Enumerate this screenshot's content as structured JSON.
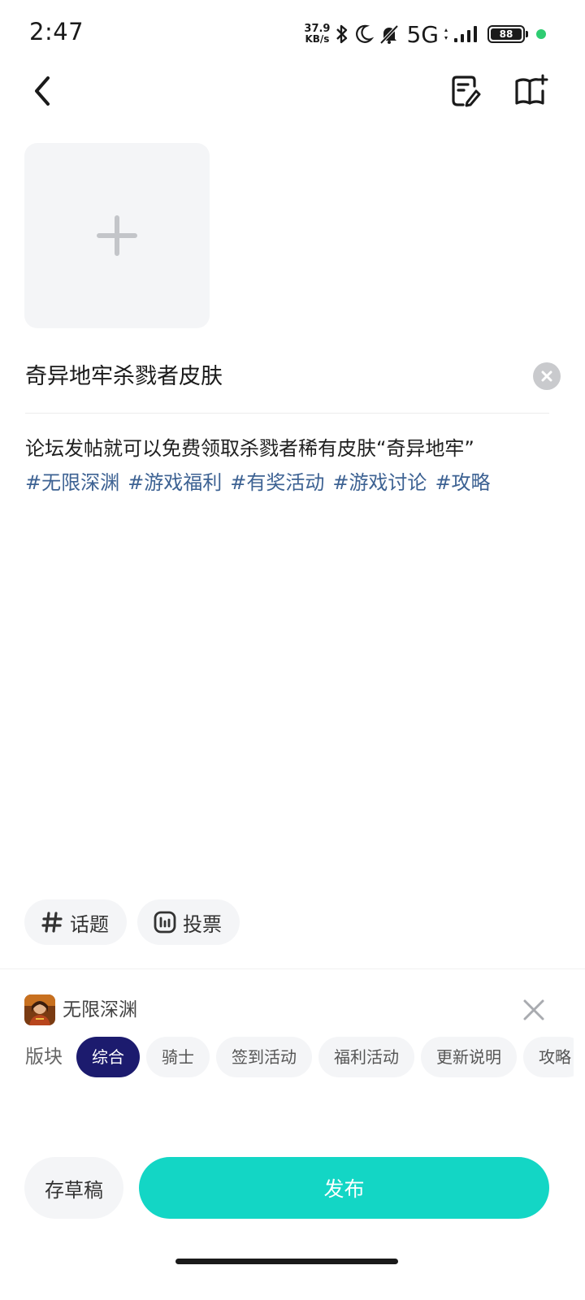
{
  "status_bar": {
    "time": "2:47",
    "net_speed_value": "37.9",
    "net_speed_unit": "KB/s",
    "network_type": "5G",
    "battery_level": "88",
    "icons": [
      "bluetooth-icon",
      "moon-icon",
      "bell-muted-icon",
      "signal-icon",
      "battery-icon"
    ]
  },
  "header": {
    "icons": [
      "back-icon",
      "edit-note-icon",
      "guide-book-icon"
    ]
  },
  "editor": {
    "title": "奇异地牢杀戮者皮肤",
    "body": "论坛发帖就可以免费领取杀戮者稀有皮肤“奇异地牢”",
    "tags": [
      "#无限深渊",
      "#游戏福利",
      "#有奖活动",
      "#游戏讨论",
      "#攻略"
    ]
  },
  "tools": {
    "topic_label": "话题",
    "vote_label": "投票"
  },
  "game": {
    "name": "无限深渊"
  },
  "board": {
    "label": "版块",
    "selected": "综合",
    "options": [
      "综合",
      "骑士",
      "签到活动",
      "福利活动",
      "更新说明",
      "攻略"
    ]
  },
  "actions": {
    "draft_label": "存草稿",
    "publish_label": "发布"
  },
  "colors": {
    "accent": "#13d6c5",
    "tag_link": "#3d6293",
    "board_active": "#1c1b6e",
    "chip_bg": "#f4f5f7"
  }
}
